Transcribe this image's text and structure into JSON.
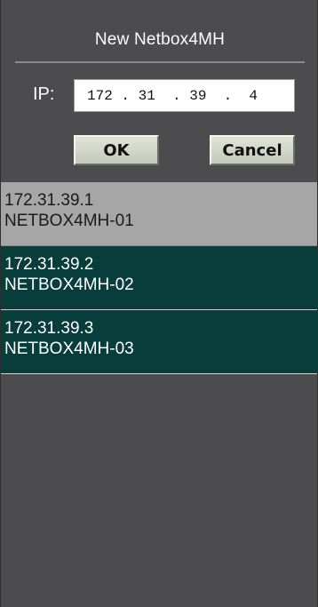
{
  "dialog": {
    "title": "New  Netbox4MH",
    "ip_label": "IP:",
    "ip_value": "172 . 31  . 39  .  4",
    "ok_label": "OK",
    "cancel_label": "Cancel"
  },
  "devices": [
    {
      "ip": "172.31.39.1",
      "name": "NETBOX4MH-01",
      "selected": true
    },
    {
      "ip": "172.31.39.2",
      "name": "NETBOX4MH-02",
      "selected": false
    },
    {
      "ip": "172.31.39.3",
      "name": "NETBOX4MH-03",
      "selected": false
    }
  ],
  "colors": {
    "panel_bg": "#4c4c4e",
    "selected_row": "#a6a6a6",
    "row_bg": "#073d3b"
  }
}
